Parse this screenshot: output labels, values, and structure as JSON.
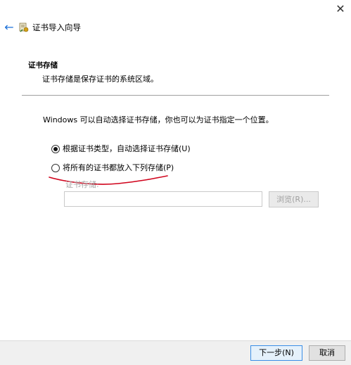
{
  "window": {
    "close_glyph": "✕",
    "back_glyph": "←",
    "title": "证书导入向导",
    "icon": "certificate-wizard-icon"
  },
  "header": {
    "heading": "证书存储",
    "description": "证书存储是保存证书的系统区域。"
  },
  "content": {
    "intro": "Windows 可以自动选择证书存储，你也可以为证书指定一个位置。",
    "options": [
      {
        "label": "根据证书类型，自动选择证书存储(U)",
        "checked": true
      },
      {
        "label": "将所有的证书都放入下列存储(P)",
        "checked": false
      }
    ],
    "store_label": "证书存储:",
    "store_value": "",
    "browse_label": "浏览(R)..."
  },
  "annotation": {
    "color": "#d0021b"
  },
  "footer": {
    "next_label": "下一步(N)",
    "cancel_label": "取消"
  }
}
